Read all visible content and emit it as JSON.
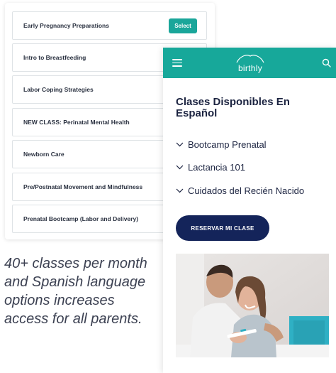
{
  "classes": [
    {
      "label": "Early Pregnancy Preparations",
      "action": "Select"
    },
    {
      "label": "Intro to Breastfeeding"
    },
    {
      "label": "Labor Coping Strategies"
    },
    {
      "label": "NEW CLASS: Perinatal Mental Health"
    },
    {
      "label": "Newborn Care"
    },
    {
      "label": "Pre/Postnatal Movement and Mindfulness"
    },
    {
      "label": "Prenatal Bootcamp (Labor and Delivery)"
    }
  ],
  "caption": "40+ classes per month and Spanish language options increases access for all parents.",
  "phone": {
    "header": {
      "logo_text": "birthly",
      "menu_icon": "hamburger-menu-icon",
      "search_icon": "search-icon",
      "color": "#17a89a"
    },
    "title": "Clases Disponibles En Español",
    "accordion": [
      {
        "label": "Bootcamp Prenatal",
        "icon": "chevron-down-icon"
      },
      {
        "label": "Lactancia 101",
        "icon": "chevron-down-icon"
      },
      {
        "label": "Cuidados del Recién Nacido",
        "icon": "chevron-down-icon"
      }
    ],
    "cta_label": "RESERVAR MI CLASE",
    "cta_color": "#14245a",
    "photo": "couple-photo"
  },
  "colors": {
    "accent_teal": "#1aa69a",
    "navy": "#14245a",
    "text_dark": "#1b2340"
  }
}
